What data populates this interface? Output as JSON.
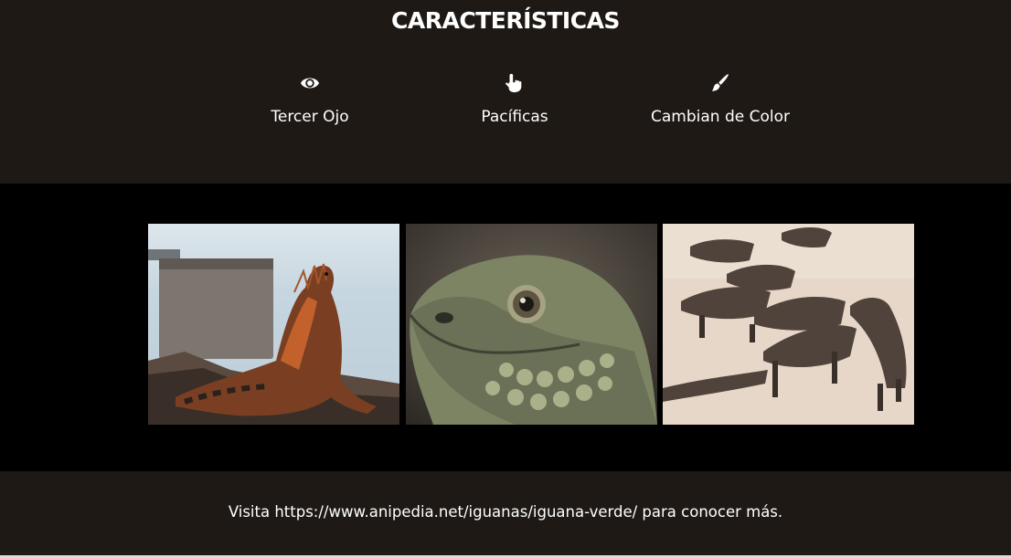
{
  "features": {
    "title": "CARACTERÍSTICAS",
    "items": [
      {
        "icon": "eye-icon",
        "label": "Tercer Ojo"
      },
      {
        "icon": "pointing-hand-icon",
        "label": "Pacíficas"
      },
      {
        "icon": "paintbrush-icon",
        "label": "Cambian de Color"
      }
    ]
  },
  "gallery": {
    "images": [
      {
        "name": "iguana-by-water-photo"
      },
      {
        "name": "iguana-head-closeup-photo"
      },
      {
        "name": "iguanas-group-beach-photo"
      }
    ]
  },
  "footer": {
    "text": "Visita https://www.anipedia.net/iguanas/iguana-verde/ para conocer más."
  },
  "colors": {
    "dark_band": "#1e1915",
    "gallery_background": "#000000",
    "text": "#ffffff"
  }
}
